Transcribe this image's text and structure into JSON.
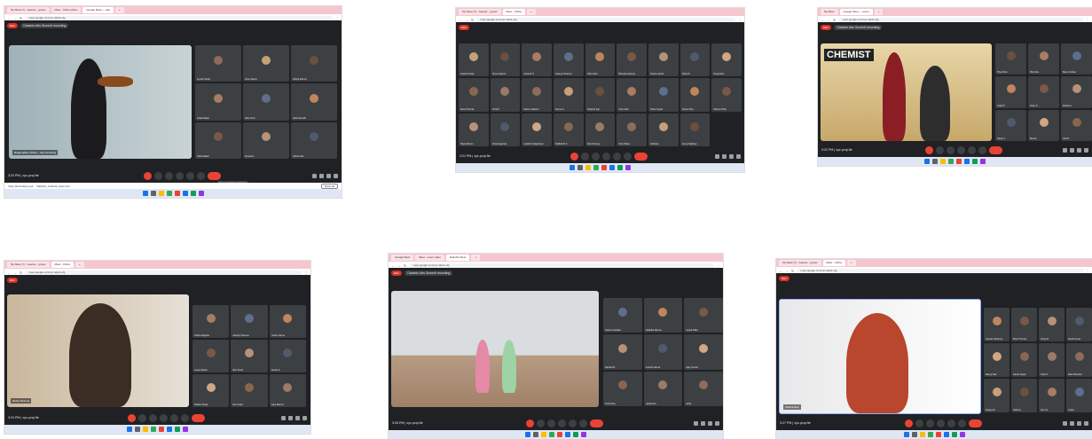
{
  "shots": [
    {
      "tabs": [
        "My Meet (7) - Gaurav - gmeet",
        "Meet - Chitra Video",
        "Google Meet — ask"
      ],
      "url": "meet.google.com/xyz-abcd-efg",
      "rec_badge": "REC",
      "rec_text": "Dakshin Arts Summit recording",
      "time": "3:20 PM | xyz-pvqi-fte",
      "main_label": "Ragamalika (Violin) – live recording",
      "tiles": [
        "Ayushi Singh",
        "Anna Nayar",
        "Aditya Menon",
        "Anjali Rajan",
        "Alsa Vivel",
        "Aarti Kamath",
        "Aisha Baker",
        "Ali Aamir",
        "Athira Nair"
      ],
      "tooltip": "Turn on captions and more",
      "downloads": [
        "View_Recording.mp4",
        "Dakshin_Cultural_Fest.mp4"
      ],
      "show_all": "Show all"
    },
    {
      "tabs": [
        "My Meet (7) - Gaurav - gmeet",
        "Meet - Chitra"
      ],
      "url": "meet.google.com/xyz-abcd-efg",
      "rec_badge": "REC",
      "time": "3:21 PM | xyz-pvqi-fte",
      "tiles": [
        "Anshul Singh",
        "Divya Kapoor",
        "Aravind R",
        "Ananya Sharma",
        "Aditi Joshi",
        "Bhavana Menon",
        "Sneha Jacob",
        "Rahul K",
        "Pooja Rao",
        "Sara Thomas",
        "Rohit P",
        "Harini Lakshmi",
        "Kavya S",
        "Meghna Iyer",
        "Arjun Das",
        "Neha Gupta",
        "Ishaan Roy",
        "Fatima Khan",
        "Nitya Menon",
        "Vivek Agarwal",
        "Lakshmi Raghavan",
        "Siddharth K",
        "Tara Shenoy",
        "Kiran Bose",
        "Akshara",
        "Jenny Mathew"
      ]
    },
    {
      "tabs": [
        "My Meet",
        "Google Meet — event"
      ],
      "url": "meet.google.com/xyz-abcd-efg",
      "rec_badge": "REC",
      "rec_text": "Dakshin Arts Summit recording",
      "time": "3:22 PM | xyz-pvqi-fte",
      "banner": "CHEMIST",
      "tiles": [
        "Priya Rao",
        "Ritu Das",
        "Manu Kurian",
        "Anjali P",
        "Kiran N",
        "Reshma",
        "Sanju V",
        "Meera",
        "Gita R"
      ]
    },
    {
      "tabs": [
        "My Meet (7) - Gaurav - gmeet",
        "Meet - Chitra"
      ],
      "url": "meet.google.com/xyz-abcd-efg",
      "rec_badge": "REC",
      "time": "3:24 PM | xyz-pvqi-fte",
      "main_label": "Rahul Sharma",
      "tiles": [
        "Anitha Raghav",
        "Akshay Sharma",
        "Lekha Varma",
        "Aryan Mehta",
        "Ritu Sood",
        "Rohan K",
        "Shalini Singh",
        "Dev Patel",
        "Jaya Menon"
      ]
    },
    {
      "tabs": [
        "Google Meet",
        "Meet - event video",
        "Dakshin Meet"
      ],
      "url": "meet.google.com/xyz-abcd-efg",
      "rec_badge": "REC",
      "rec_text": "Dakshin Arts Summit recording",
      "time": "3:26 PM | xyz-pvqi-fte",
      "tiles": [
        "Sneha Shankar",
        "Radhika Menon",
        "Gopal Pillai",
        "Nandini B",
        "Keerthi Varma",
        "Ajay Kumar",
        "Smita Roy",
        "Lakshman",
        "Asha"
      ]
    },
    {
      "tabs": [
        "My Meet (7) - Gaurav - gmeet",
        "Meet - Chitra"
      ],
      "url": "meet.google.com/xyz-abcd-efg",
      "rec_badge": "REC",
      "time": "3:27 PM | xyz-pvqi-fte",
      "main_label": "Karthik Rao",
      "tiles": [
        "Gautam Sharma",
        "Bina Thomas",
        "Vidya R",
        "Sunil Kumar",
        "Manoj Nair",
        "Kavita Singh",
        "Yash P",
        "Ravi Shankar",
        "Deepa M",
        "Nisha A",
        "Arun G",
        "Leela"
      ]
    }
  ]
}
